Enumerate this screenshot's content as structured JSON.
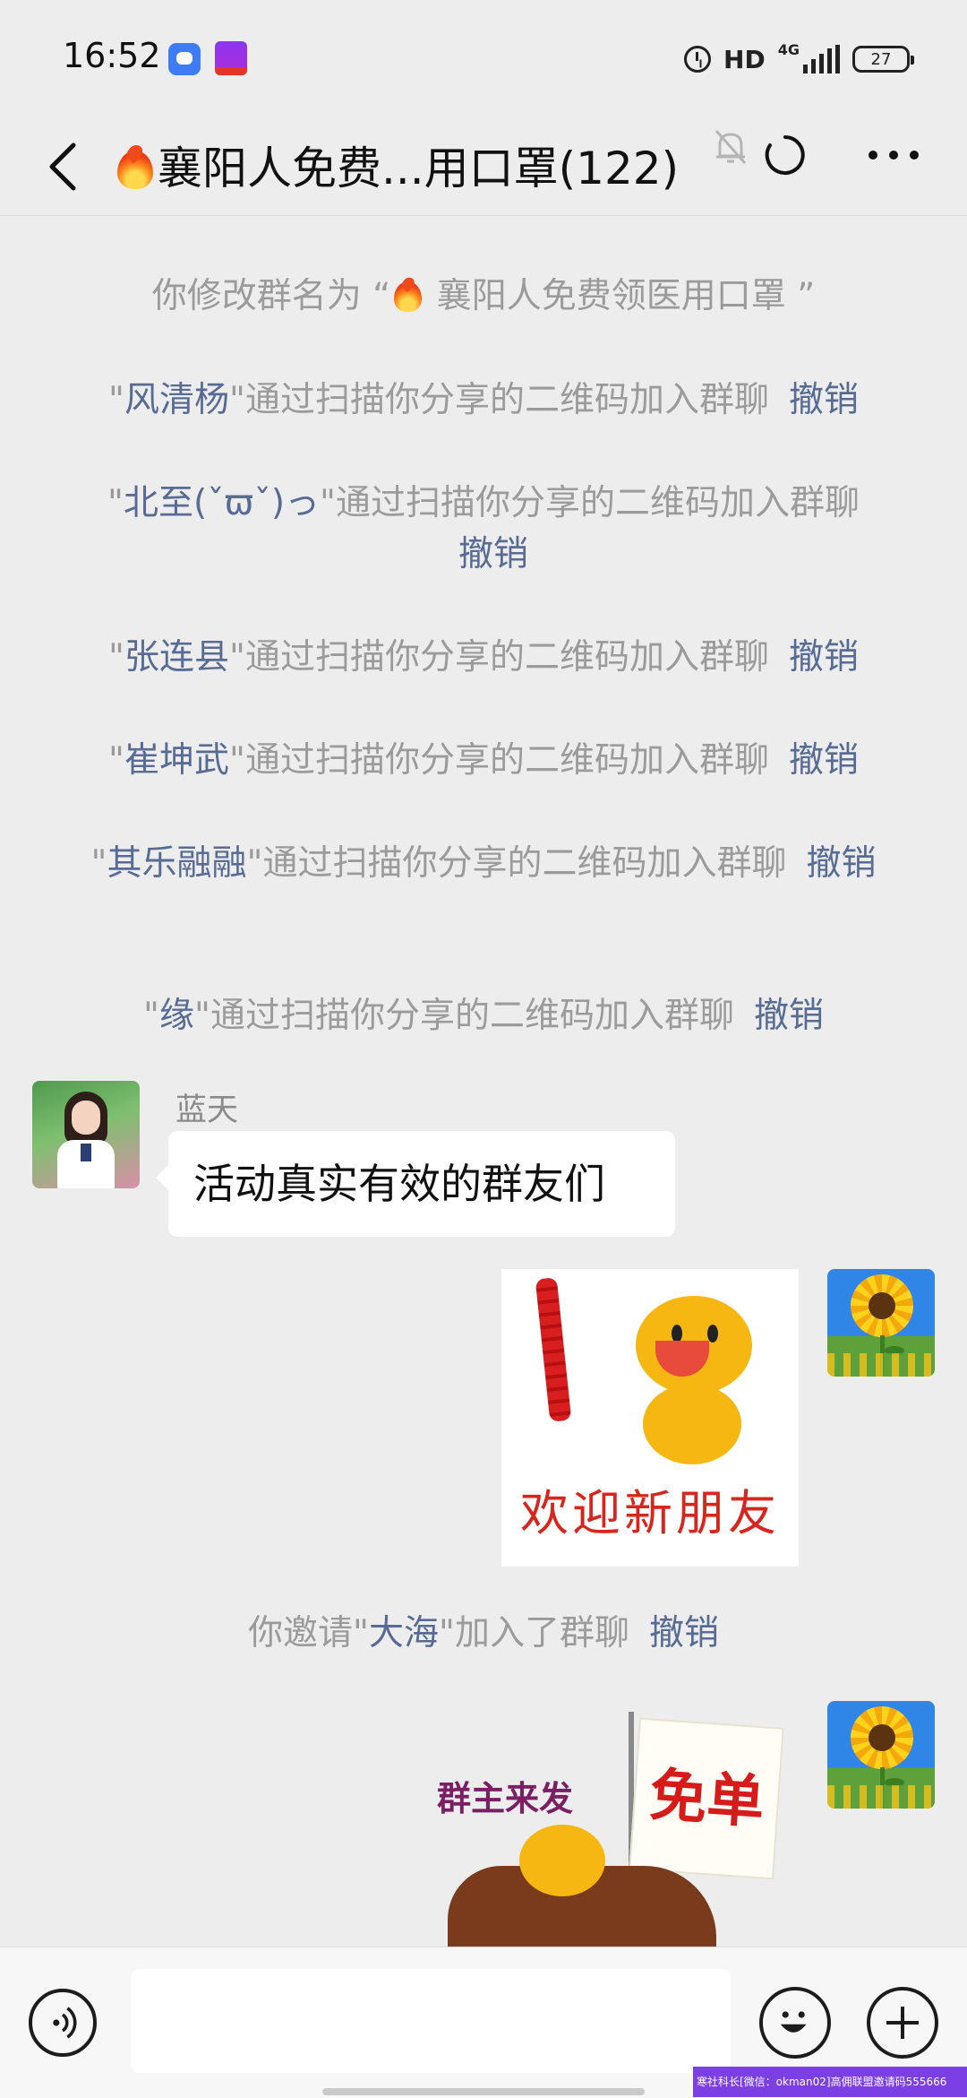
{
  "status_bar": {
    "time": "16:52",
    "network": "HD",
    "network_type": "4G",
    "battery": "27",
    "signal_level": 0.8
  },
  "chat_header": {
    "title": "襄阳人免费...用口罩(122)",
    "icons": [
      "back-arrow-icon",
      "fire-emoji-icon",
      "mute-bell-icon",
      "refresh-icon",
      "more-dots-icon"
    ]
  },
  "messages": {
    "rename": {
      "prefix": "你修改群名为 “",
      "group_name": " 襄阳人免费领医用口罩 ",
      "suffix": "”"
    },
    "join1": {
      "quote_open": "\"",
      "name": "风清杨",
      "text": "\"通过扫描你分享的二维码加入群聊",
      "undo": "撤销"
    },
    "join2": {
      "quote_open": "\"",
      "name": "北至(ˇϖˇ)っ",
      "text": "\"通过扫描你分享的二维码加入群聊",
      "undo": "撤销"
    },
    "join3": {
      "quote_open": "\"",
      "name": "张连县",
      "text": "\"通过扫描你分享的二维码加入群聊",
      "undo": "撤销"
    },
    "join4": {
      "quote_open": "\"",
      "name": "崔坤武",
      "text": "\"通过扫描你分享的二维码加入群聊",
      "undo": "撤销"
    },
    "join5": {
      "quote_open": "\"",
      "name": "其乐融融",
      "text": "\"通过扫描你分享的二维码加入群聊",
      "undo": "撤销"
    },
    "join6": {
      "quote_open": "\"",
      "name": "缘",
      "text": "\"通过扫描你分享的二维码加入群聊",
      "undo": "撤销"
    },
    "chat1": {
      "sender": "蓝天",
      "text": "活动真实有效的群友们"
    },
    "sticker1": {
      "caption": "欢迎新朋友"
    },
    "invite": {
      "prefix": "你邀请\"",
      "name": "大海",
      "suffix": "\"加入了群聊",
      "undo": "撤销"
    },
    "sticker2": {
      "left_text": "群主来发",
      "flag_text": "免单"
    }
  },
  "input_bar": {
    "value": "",
    "icons": [
      "voice-icon",
      "emoji-icon",
      "plus-icon"
    ]
  },
  "watermark": "寒社科长[微信：okman02]高佣联盟邀请码555666",
  "colors": {
    "background": "#ededed",
    "link": "#576b95",
    "system_text": "#9b9b9b",
    "bubble": "#ffffff"
  }
}
